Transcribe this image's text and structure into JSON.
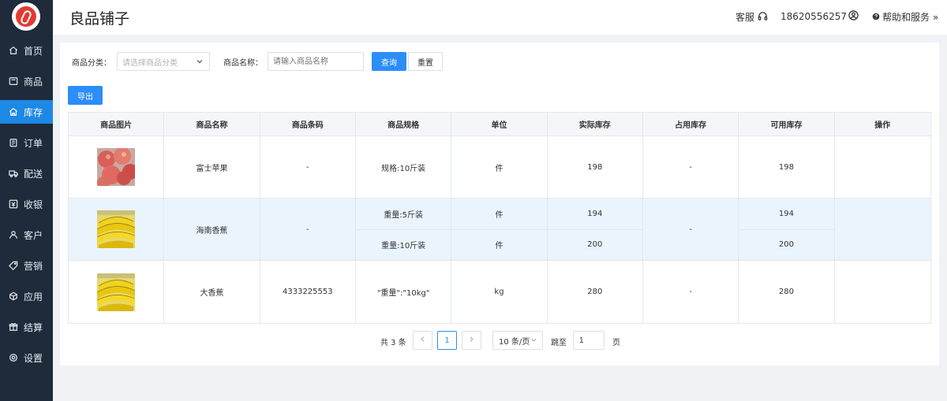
{
  "app": {
    "title": "良品铺子"
  },
  "header": {
    "service_label": "客服",
    "phone": "18620556257",
    "help_label": "帮助和服务"
  },
  "sidebar": {
    "items": [
      {
        "label": "首页",
        "icon": "home-icon",
        "active": false
      },
      {
        "label": "商品",
        "icon": "product-icon",
        "active": false
      },
      {
        "label": "库存",
        "icon": "inventory-icon",
        "active": true
      },
      {
        "label": "订单",
        "icon": "order-icon",
        "active": false
      },
      {
        "label": "配送",
        "icon": "delivery-icon",
        "active": false
      },
      {
        "label": "收银",
        "icon": "cashier-icon",
        "active": false
      },
      {
        "label": "客户",
        "icon": "customer-icon",
        "active": false
      },
      {
        "label": "营销",
        "icon": "marketing-icon",
        "active": false
      },
      {
        "label": "应用",
        "icon": "app-icon",
        "active": false
      },
      {
        "label": "结算",
        "icon": "settlement-icon",
        "active": false
      },
      {
        "label": "设置",
        "icon": "settings-icon",
        "active": false
      }
    ]
  },
  "filters": {
    "category_label": "商品分类：",
    "category_placeholder": "请选择商品分类",
    "name_label": "商品名称：",
    "name_placeholder": "请输入商品名称",
    "query_label": "查询",
    "reset_label": "重置",
    "export_label": "导出"
  },
  "table": {
    "headers": [
      "商品图片",
      "商品名称",
      "商品条码",
      "商品规格",
      "单位",
      "实际库存",
      "占用库存",
      "可用库存",
      "操作"
    ],
    "rows": [
      {
        "name": "富士苹果",
        "barcode": "-",
        "specs": [
          "规格:10斤装"
        ],
        "units": [
          "件"
        ],
        "actual": [
          "198"
        ],
        "occupied": "-",
        "available": [
          "198"
        ],
        "image": "apple",
        "highlight": false
      },
      {
        "name": "海南香蕉",
        "barcode": "-",
        "specs": [
          "重量:5斤装",
          "重量:10斤装"
        ],
        "units": [
          "件",
          "件"
        ],
        "actual": [
          "194",
          "200"
        ],
        "occupied": "-",
        "available": [
          "194",
          "200"
        ],
        "image": "banana",
        "highlight": true
      },
      {
        "name": "大香蕉",
        "barcode": "4333225553",
        "specs": [
          "\"重量\":\"10kg\""
        ],
        "units": [
          "kg"
        ],
        "actual": [
          "280"
        ],
        "occupied": "-",
        "available": [
          "280"
        ],
        "image": "banana",
        "highlight": false
      }
    ]
  },
  "pagination": {
    "total_text": "共 3 条",
    "current_page": "1",
    "page_size": "10 条/页",
    "goto_label": "跳至",
    "goto_value": "1",
    "page_unit": "页"
  },
  "colors": {
    "sidebar_bg": "#1f2b3a",
    "accent": "#1e88e5",
    "primary_button": "#2c8ef8",
    "row_highlight": "#eaf4fd"
  }
}
